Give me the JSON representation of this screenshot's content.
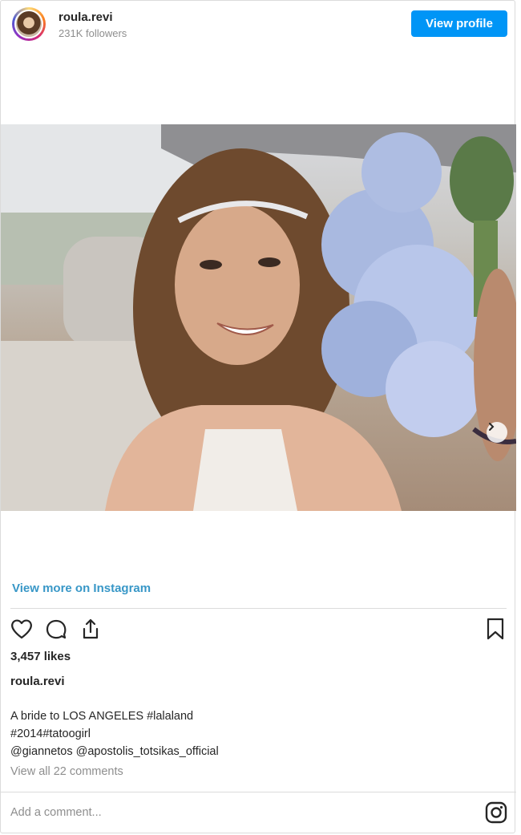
{
  "header": {
    "username": "roula.revi",
    "followers": "231K followers",
    "view_profile_label": "View profile"
  },
  "post": {
    "view_more_label": "View more on Instagram",
    "likes": "3,457 likes",
    "author": "roula.revi",
    "caption_lines": [
      "A bride to LOS ANGELES #lalaland",
      "#2014#tatoogirl",
      "@giannetos @apostolis_totsikas_official"
    ],
    "view_comments_label": "View all 22 comments"
  },
  "footer": {
    "add_comment_placeholder": "Add a comment..."
  },
  "icons": {
    "like": "heart-icon",
    "comment": "comment-icon",
    "share": "share-icon",
    "save": "bookmark-icon",
    "carousel_next": "chevron-right-icon",
    "instagram": "instagram-icon"
  },
  "colors": {
    "accent_button": "#0095f6",
    "link": "#3897c7",
    "muted_text": "#8e8e8e"
  }
}
